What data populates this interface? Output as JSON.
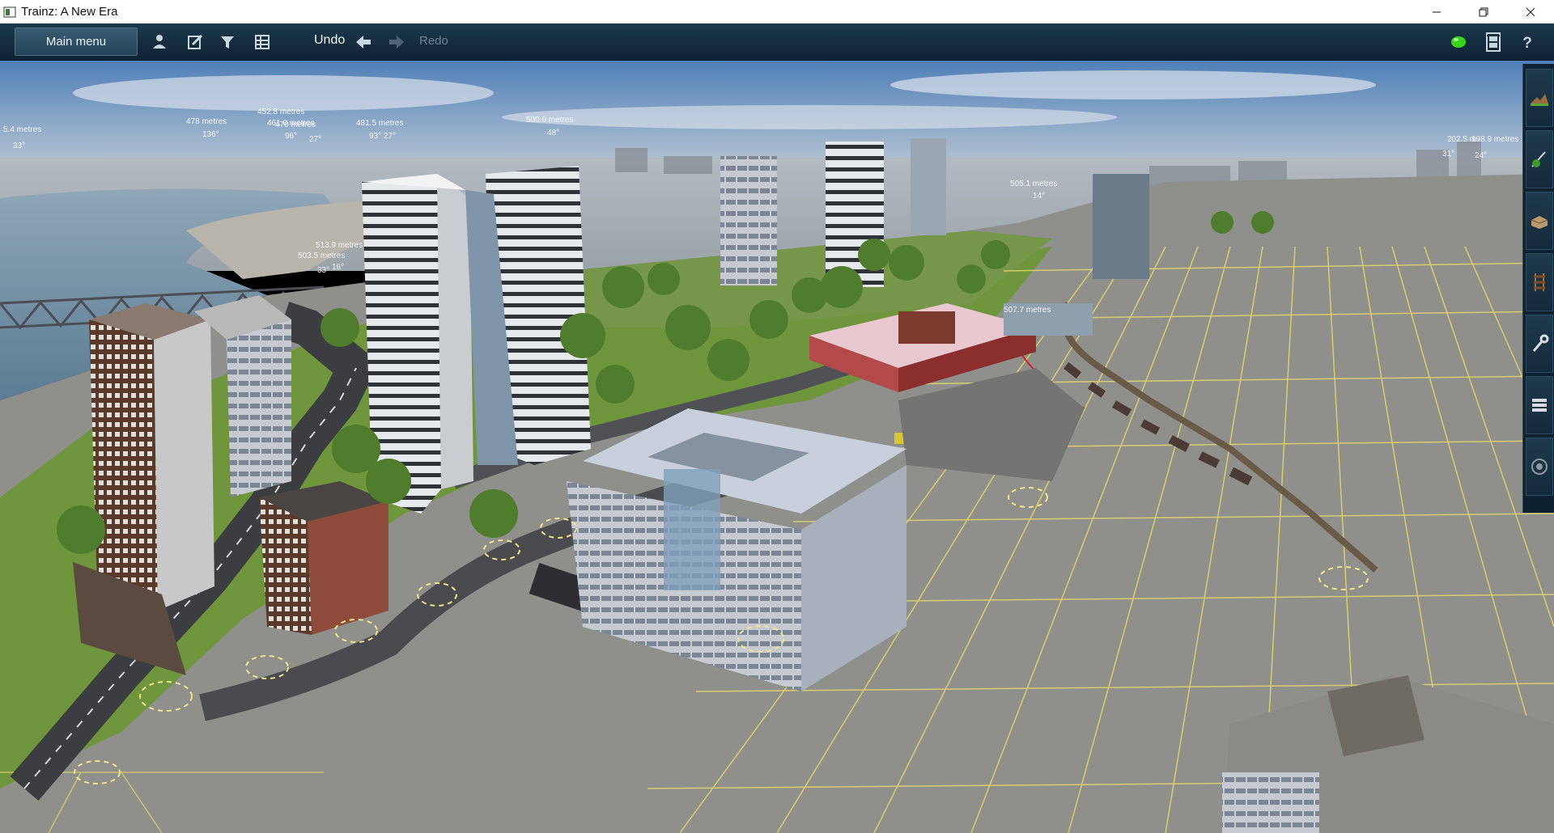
{
  "window": {
    "title": "Trainz: A New Era",
    "controls": [
      "minimize-icon",
      "restore-icon",
      "close-icon"
    ]
  },
  "toolbar": {
    "main_menu_label": "Main menu",
    "icons": [
      "driver-icon",
      "edit-icon",
      "filter-icon",
      "grid-icon"
    ],
    "undo_label": "Undo",
    "redo_label": "Redo",
    "right_icons": [
      "status-indicator-icon",
      "film-icon",
      "help-icon"
    ],
    "status_color": "#39d41c"
  },
  "scene": {
    "distance_labels": [
      "5.4 metres",
      "33°",
      "478 metres",
      "136°",
      "452.8 metres",
      "461.0 metres",
      "96°",
      "470 metres",
      "27°",
      "481.5 metres",
      "93° 27°",
      "500.0 metres",
      "48°",
      "513.9 metres",
      "503.5 metres",
      "16°",
      "33°",
      "505.1 metres",
      "14°",
      "507.7 metres",
      "202.5 m",
      "198.9 metres",
      "31°",
      "24°"
    ]
  },
  "palette": {
    "tools": [
      "terrain-tool-icon",
      "vegetation-tool-icon",
      "objects-tool-icon",
      "track-tool-icon",
      "wrench-tool-icon",
      "layers-tool-icon",
      "session-tool-icon"
    ]
  },
  "colors": {
    "toolbar_bg": "#132d3d",
    "grid_line": "#e5d86a",
    "water": "#6f8ea6",
    "grass": "#6f963d"
  }
}
